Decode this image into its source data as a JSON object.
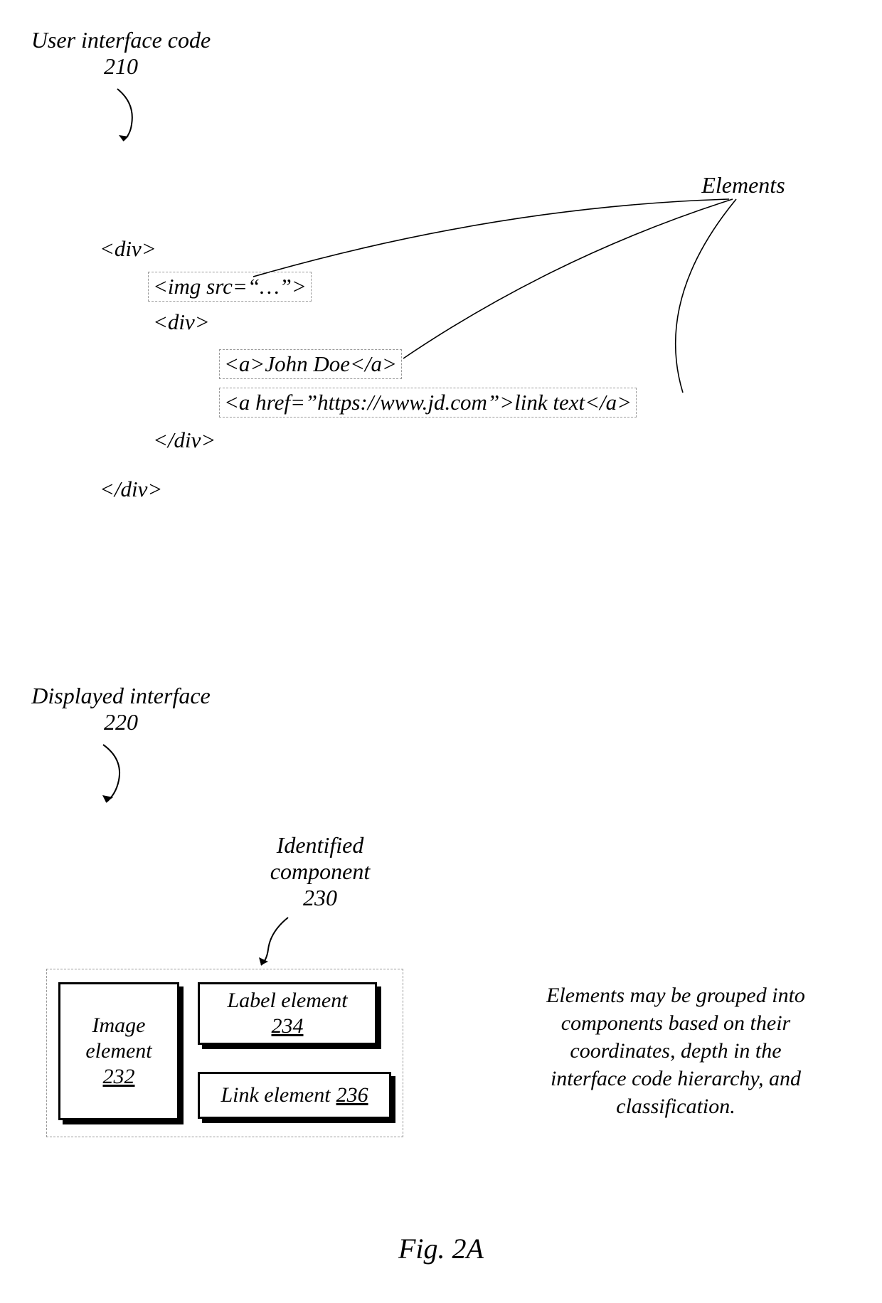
{
  "section1": {
    "title_line1": "User interface code",
    "title_num": "210",
    "elements_label": "Elements",
    "code": {
      "div_open": "<div>",
      "img": "<img src=“…”>",
      "div2_open": "<div>",
      "a1": "<a>John Doe</a>",
      "a2": "<a href=”https://www.jd.com”>link text</a>",
      "div2_close": "</div>",
      "div_close": "</div>"
    }
  },
  "section2": {
    "title_line1": "Displayed interface",
    "title_num": "220",
    "component_label_line1": "Identified",
    "component_label_line2": "component",
    "component_num": "230",
    "image_el_line1": "Image",
    "image_el_line2": "element",
    "image_el_num": "232",
    "label_el_line1": "Label element",
    "label_el_num": "234",
    "link_el_line1": "Link element",
    "link_el_line2_num": "236",
    "desc_line1": "Elements may be grouped into",
    "desc_line2": "components based on their",
    "desc_line3": "coordinates, depth in the",
    "desc_line4": "interface code hierarchy, and",
    "desc_line5": "classification."
  },
  "fig": "Fig. 2A"
}
